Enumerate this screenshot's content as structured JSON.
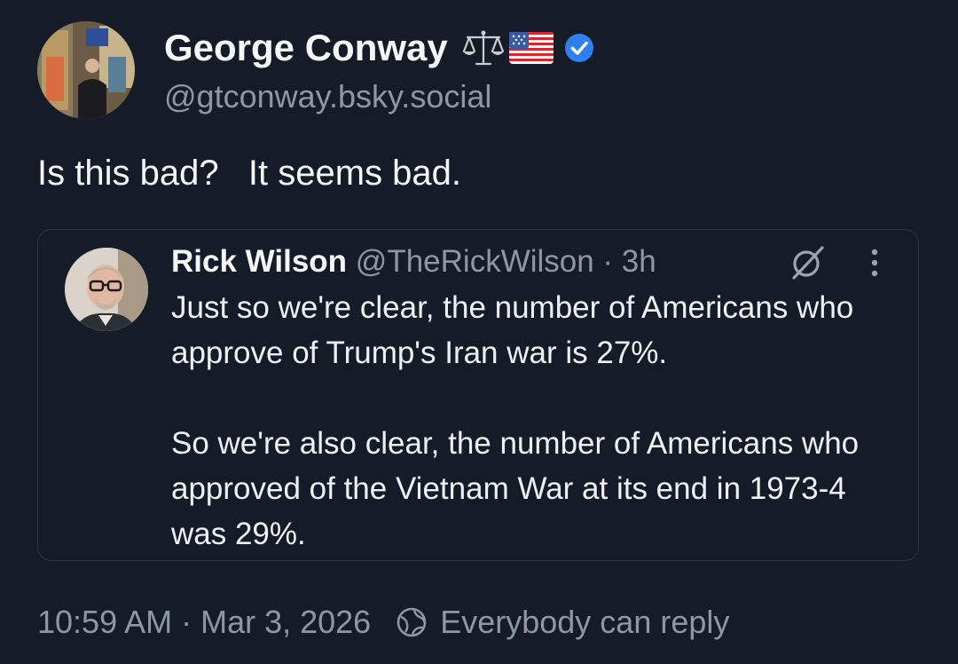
{
  "post": {
    "author": {
      "name": "George Conway",
      "handle": "@gtconway.bsky.social",
      "badges": [
        "scales-icon",
        "us-flag-icon",
        "verified-check-icon"
      ]
    },
    "text": "Is this bad?   It seems bad.",
    "quote": {
      "author_name": "Rick Wilson",
      "author_meta": "@TheRickWilson · 3h",
      "body": "Just so we're clear, the number of Americans who approve of Trump's Iran war is 27%.\n\nSo we're also clear, the number of Americans who approved of the Vietnam War at its end in 1973-4 was 29%."
    },
    "footer": {
      "timestamp": "10:59 AM · Mar 3, 2026",
      "reply_setting": "Everybody can reply"
    }
  },
  "colors": {
    "background": "#161c27",
    "verified": "#2f80ed",
    "muted_text": "#8d97a5"
  }
}
